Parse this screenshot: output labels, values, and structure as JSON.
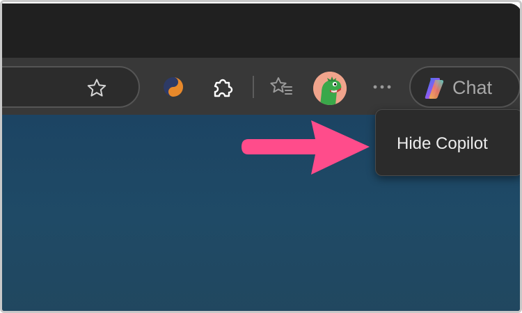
{
  "toolbar": {
    "icons": {
      "favorite": "star-outline-icon",
      "extension_s": "s-extension-icon",
      "extensions": "puzzle-icon",
      "favorites": "favorites-list-icon",
      "profile": "dinosaur-avatar",
      "more": "ellipsis-icon",
      "copilot": "copilot-logo-icon"
    },
    "chat_label": "Chat"
  },
  "context_menu": {
    "items": [
      {
        "label": "Hide Copilot"
      }
    ]
  },
  "colors": {
    "titlebar": "#202020",
    "toolbar": "#383838",
    "menu_bg": "#2b2b2b",
    "page_bg": "#1f4a66",
    "arrow": "#ff4c8b"
  }
}
